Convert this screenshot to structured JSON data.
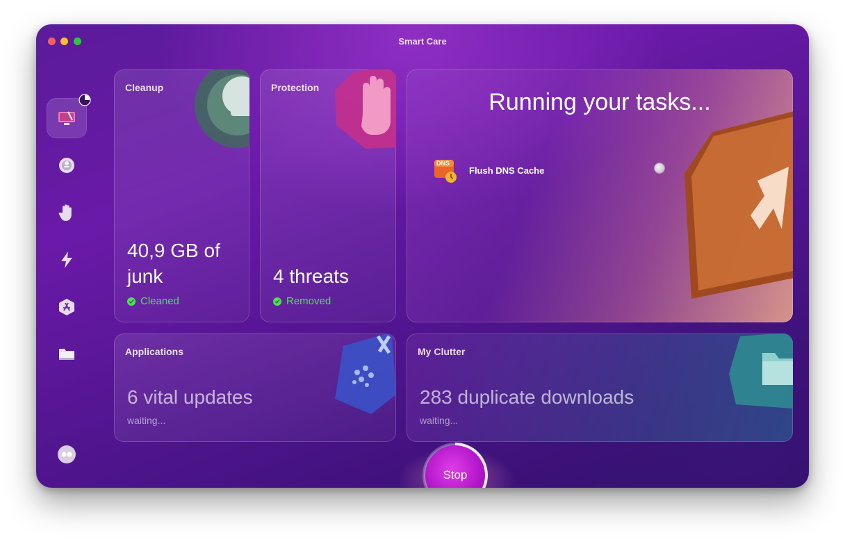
{
  "window": {
    "title": "Smart Care"
  },
  "sidebar": {
    "items": [
      {
        "name": "smart-care",
        "icon": "monitor-sweep-icon"
      },
      {
        "name": "cleanup",
        "icon": "cleanup-disc-icon"
      },
      {
        "name": "protection",
        "icon": "hand-icon"
      },
      {
        "name": "performance",
        "icon": "lightning-icon"
      },
      {
        "name": "applications",
        "icon": "app-store-icon"
      },
      {
        "name": "my-clutter",
        "icon": "folder-icon"
      }
    ],
    "footer_icon": "assistant-icon"
  },
  "cards": {
    "cleanup": {
      "label": "Cleanup",
      "value_line1": "40,9 GB of",
      "value_line2": "junk",
      "status": "Cleaned"
    },
    "protection": {
      "label": "Protection",
      "value": "4 threats",
      "status": "Removed"
    },
    "applications": {
      "label": "Applications",
      "value": "6 vital updates",
      "status": "waiting..."
    },
    "my_clutter": {
      "label": "My Clutter",
      "value": "283 duplicate downloads",
      "status": "waiting..."
    }
  },
  "running": {
    "title": "Running your tasks...",
    "task": {
      "icon": "dns-icon",
      "icon_text": "DNS",
      "name": "Flush DNS Cache"
    }
  },
  "stop_button": {
    "label": "Stop"
  },
  "colors": {
    "accent": "#b014c8",
    "success": "#4fe05a"
  }
}
